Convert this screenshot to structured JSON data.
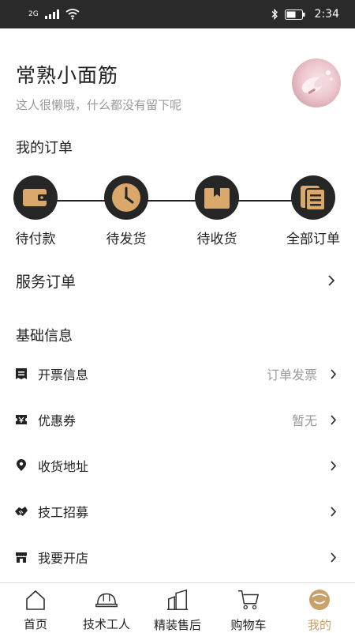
{
  "status_bar": {
    "network": "2G",
    "time": "2:34"
  },
  "profile": {
    "username": "常熟小面筋",
    "bio": "这人很懒哦，什么都没有留下呢"
  },
  "orders": {
    "title": "我的订单",
    "items": [
      {
        "label": "待付款",
        "icon": "wallet-icon"
      },
      {
        "label": "待发货",
        "icon": "clock-icon"
      },
      {
        "label": "待收货",
        "icon": "box-icon"
      },
      {
        "label": "全部订单",
        "icon": "order-list-icon"
      }
    ]
  },
  "service_orders": {
    "label": "服务订单"
  },
  "basic_info": {
    "title": "基础信息",
    "items": [
      {
        "label": "开票信息",
        "value": "订单发票",
        "icon": "invoice-icon"
      },
      {
        "label": "优惠券",
        "value": "暂无",
        "icon": "coupon-icon"
      },
      {
        "label": "收货地址",
        "value": "",
        "icon": "location-pin-icon"
      },
      {
        "label": "技工招募",
        "value": "",
        "icon": "handshake-icon"
      },
      {
        "label": "我要开店",
        "value": "",
        "icon": "store-icon"
      }
    ]
  },
  "tabbar": {
    "items": [
      {
        "label": "首页",
        "icon": "home-icon"
      },
      {
        "label": "技术工人",
        "icon": "helmet-icon"
      },
      {
        "label": "精装售后",
        "icon": "buildings-icon"
      },
      {
        "label": "购物车",
        "icon": "cart-icon"
      },
      {
        "label": "我的",
        "icon": "profile-face-icon"
      }
    ],
    "active_index": 4
  },
  "colors": {
    "accent_gold": "#c9a16b",
    "dark": "#262626",
    "muted_text": "#9a9a9a",
    "status_bar": "#2a2a2a"
  }
}
